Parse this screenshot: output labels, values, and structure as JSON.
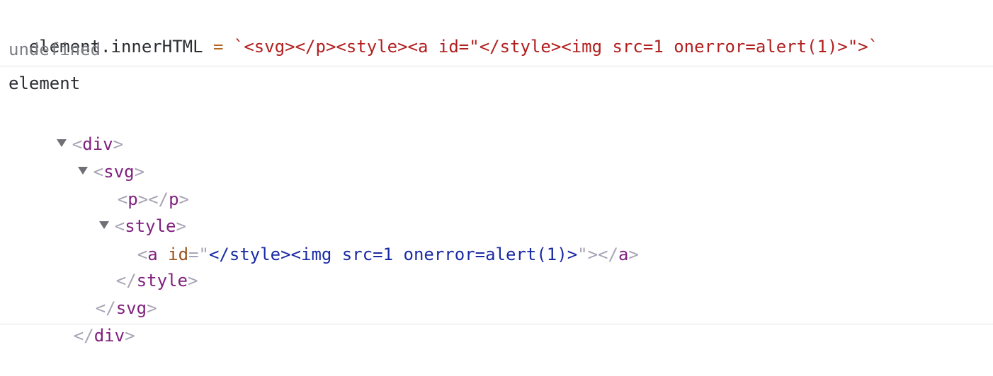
{
  "console": {
    "input": {
      "lhs": "element.innerHTML",
      "operator": "=",
      "string_value": "`<svg></p><style><a id=\"</style><img src=1 onerror=alert(1)>\">`"
    },
    "input_result": "undefined",
    "second_input": "element",
    "colors": {
      "string": "#b11f1f",
      "operator": "#b3661d",
      "muted": "#7b7e83",
      "tag": "#80217e",
      "tag_bracket": "#a9a4b5",
      "attribute_name": "#99531c",
      "attribute_value": "#1a2aa4",
      "separator": "#e4e5e7"
    }
  },
  "dom_tree": {
    "expand_icon": "triangle-down-icon",
    "nodes": {
      "div": {
        "tag": "div"
      },
      "svg": {
        "tag": "svg"
      },
      "p": {
        "tag": "p"
      },
      "style": {
        "tag": "style"
      },
      "a": {
        "tag": "a",
        "attr_name": "id",
        "attr_eq": "=",
        "attr_quote": "\"",
        "attr_value": "</style><img src=1 onerror=alert(1)>"
      }
    }
  }
}
